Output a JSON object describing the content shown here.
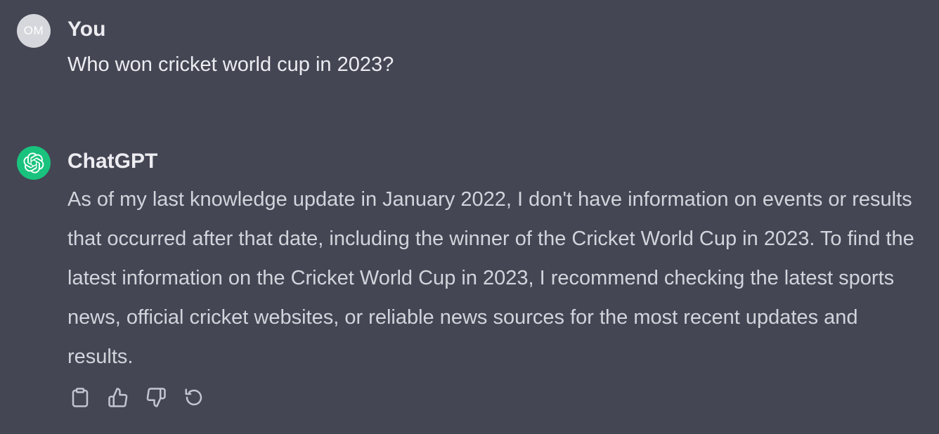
{
  "user_message": {
    "avatar_initials": "OM",
    "author": "You",
    "text": "Who won cricket world cup in 2023?"
  },
  "assistant_message": {
    "avatar_icon": "openai-logo-icon",
    "author": "ChatGPT",
    "text": "As of my last knowledge update in January 2022, I don't have information on events or results that occurred after that date, including the winner of the Cricket World Cup in 2023. To find the latest information on the Cricket World Cup in 2023, I recommend checking the latest sports news, official cricket websites, or reliable news sources for the most recent updates and results."
  },
  "actions": [
    {
      "icon": "clipboard-icon"
    },
    {
      "icon": "thumbs-up-icon"
    },
    {
      "icon": "thumbs-down-icon"
    },
    {
      "icon": "regenerate-icon"
    }
  ],
  "colors": {
    "background": "#444654",
    "bot_avatar": "#19c37d",
    "user_avatar": "#d6d7dc",
    "text": "#d1d5db"
  }
}
